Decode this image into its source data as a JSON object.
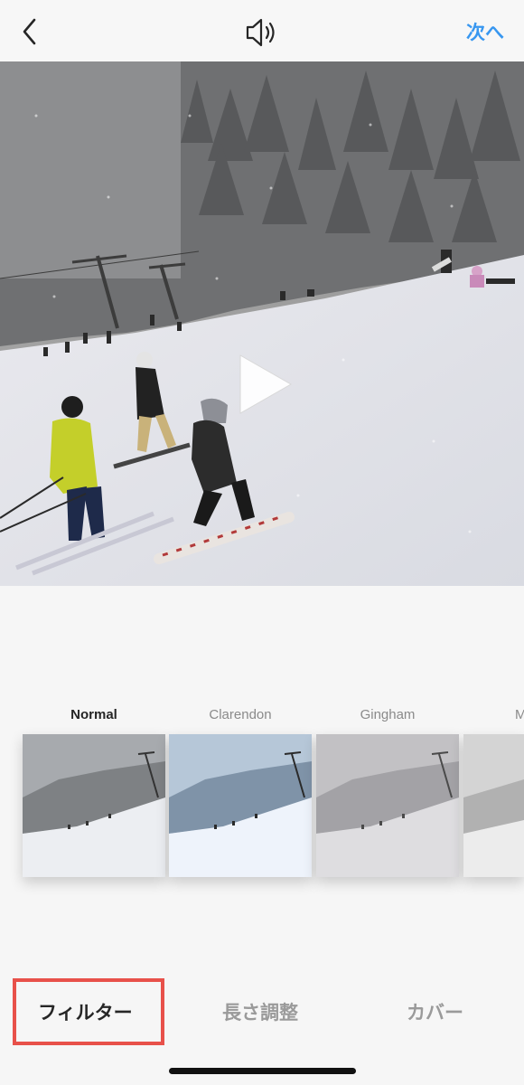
{
  "header": {
    "back_icon": "chevron-left-icon",
    "sound_icon": "speaker-icon",
    "next_label": "次へ"
  },
  "video": {
    "play_icon": "play-icon"
  },
  "filters": [
    {
      "name": "Normal",
      "selected": true
    },
    {
      "name": "Clarendon",
      "selected": false
    },
    {
      "name": "Gingham",
      "selected": false
    },
    {
      "name": "M",
      "selected": false
    }
  ],
  "tabs": [
    {
      "label": "フィルター",
      "selected": true
    },
    {
      "label": "長さ調整",
      "selected": false
    },
    {
      "label": "カバー",
      "selected": false
    }
  ],
  "colors": {
    "accent": "#3897f0",
    "highlight": "#e8514a"
  }
}
